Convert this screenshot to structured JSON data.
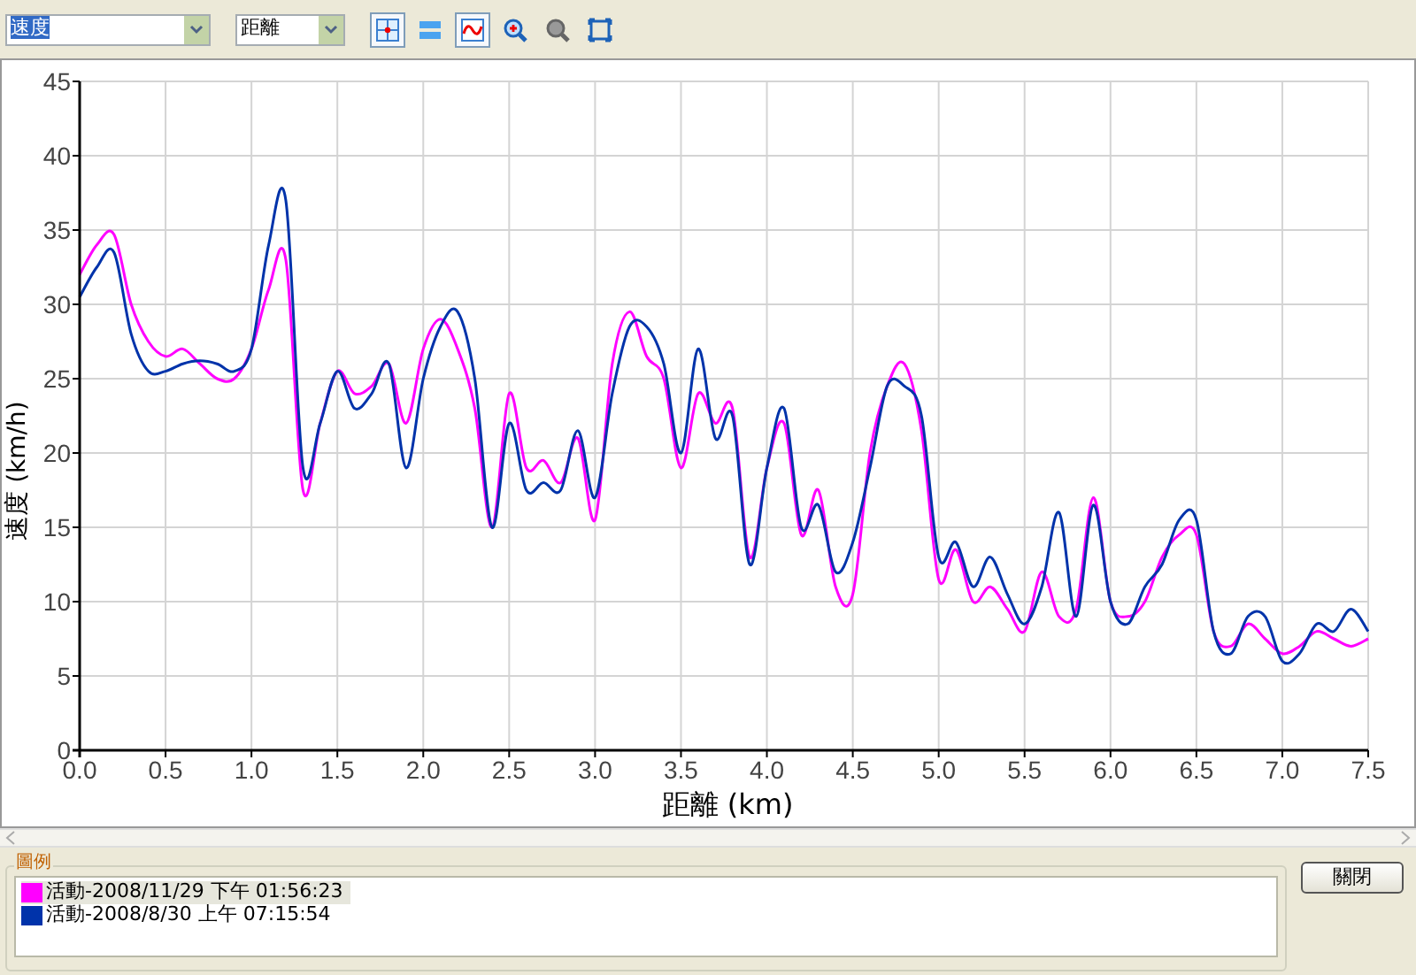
{
  "toolbar": {
    "y_field": {
      "value": "速度"
    },
    "x_field": {
      "value": "距離"
    },
    "buttons": [
      {
        "kind": "crosshair",
        "pressed": true
      },
      {
        "kind": "bands",
        "pressed": false
      },
      {
        "kind": "smooth",
        "pressed": true
      },
      {
        "kind": "zoom-in",
        "pressed": false
      },
      {
        "kind": "zoom-out",
        "pressed": false
      },
      {
        "kind": "fit",
        "pressed": false
      }
    ]
  },
  "chart": {
    "chart_data": {
      "type": "line",
      "xlabel": "距離 (km)",
      "ylabel": "速度 (km/h)",
      "x": [
        0,
        0.1,
        0.2,
        0.3,
        0.4,
        0.5,
        0.6,
        0.7,
        0.8,
        0.9,
        1.0,
        1.1,
        1.2,
        1.3,
        1.4,
        1.5,
        1.6,
        1.7,
        1.8,
        1.9,
        2.0,
        2.1,
        2.2,
        2.3,
        2.4,
        2.5,
        2.6,
        2.7,
        2.8,
        2.9,
        3.0,
        3.1,
        3.2,
        3.3,
        3.4,
        3.5,
        3.6,
        3.7,
        3.8,
        3.9,
        4.0,
        4.1,
        4.2,
        4.3,
        4.4,
        4.5,
        4.6,
        4.7,
        4.8,
        4.9,
        5.0,
        5.1,
        5.2,
        5.3,
        5.4,
        5.5,
        5.6,
        5.7,
        5.8,
        5.9,
        6.0,
        6.1,
        6.2,
        6.3,
        6.4,
        6.5,
        6.6,
        6.7,
        6.8,
        6.9,
        7.0,
        7.1,
        7.2,
        7.3,
        7.4,
        7.5
      ],
      "series": [
        {
          "name": "活動-2008/11/29 下午 01:56:23",
          "color": "#ff00ff",
          "values": [
            32,
            34,
            34.7,
            30,
            27.5,
            26.5,
            27,
            26,
            25,
            25,
            27,
            31,
            33,
            17.5,
            22,
            25.5,
            24,
            24.5,
            26,
            22,
            27,
            29,
            27,
            23,
            15,
            24,
            19,
            19.5,
            18,
            21,
            15.5,
            26,
            29.5,
            26.5,
            25,
            19,
            24,
            22,
            23,
            13,
            19,
            22,
            14.5,
            17.5,
            11,
            10.5,
            20,
            24.5,
            26,
            21.5,
            11.5,
            13.5,
            10,
            11,
            9.5,
            8,
            12,
            9,
            9.5,
            17,
            10,
            9,
            10,
            13,
            14.5,
            14.5,
            8,
            7,
            8.5,
            7.5,
            6.5,
            7,
            8,
            7.5,
            7,
            7.5
          ]
        },
        {
          "name": "活動-2008/8/30 上午 07:15:54",
          "color": "#0033aa",
          "values": [
            30.5,
            32.5,
            33.5,
            28,
            25.5,
            25.5,
            26,
            26.2,
            26,
            25.5,
            27,
            34,
            37,
            19,
            22,
            25.5,
            23,
            24,
            26,
            19,
            25,
            28.5,
            29.5,
            25,
            15,
            22,
            17.5,
            18,
            17.5,
            21.5,
            17,
            24,
            28.5,
            28.5,
            26,
            20,
            27,
            21,
            22.5,
            12.5,
            19,
            23,
            15,
            16.5,
            12,
            14,
            19,
            24.5,
            24.5,
            22.5,
            13,
            14,
            11,
            13,
            10.5,
            8.5,
            11,
            16,
            9,
            16.5,
            10,
            8.5,
            11,
            12.5,
            15.5,
            15.5,
            8,
            6.5,
            9,
            9,
            6,
            6.5,
            8.5,
            8,
            9.5,
            8
          ]
        }
      ],
      "xlim": [
        0,
        7.5
      ],
      "ylim": [
        0,
        45
      ],
      "xticks": [
        {
          "value": 0,
          "label": "0.0"
        },
        {
          "value": 0.5,
          "label": "0.5"
        },
        {
          "value": 1,
          "label": "1.0"
        },
        {
          "value": 1.5,
          "label": "1.5"
        },
        {
          "value": 2,
          "label": "2.0"
        },
        {
          "value": 2.5,
          "label": "2.5"
        },
        {
          "value": 3,
          "label": "3.0"
        },
        {
          "value": 3.5,
          "label": "3.5"
        },
        {
          "value": 4,
          "label": "4.0"
        },
        {
          "value": 4.5,
          "label": "4.5"
        },
        {
          "value": 5,
          "label": "5.0"
        },
        {
          "value": 5.5,
          "label": "5.5"
        },
        {
          "value": 6,
          "label": "6.0"
        },
        {
          "value": 6.5,
          "label": "6.5"
        },
        {
          "value": 7,
          "label": "7.0"
        },
        {
          "value": 7.5,
          "label": "7.5"
        }
      ],
      "yticks": [
        0,
        5,
        10,
        15,
        20,
        25,
        30,
        35,
        40,
        45
      ],
      "grid": true
    }
  },
  "legend": {
    "title": "圖例",
    "items": [
      {
        "selected": true
      },
      {
        "selected": false
      }
    ]
  },
  "close_button": {
    "label": "關閉"
  }
}
